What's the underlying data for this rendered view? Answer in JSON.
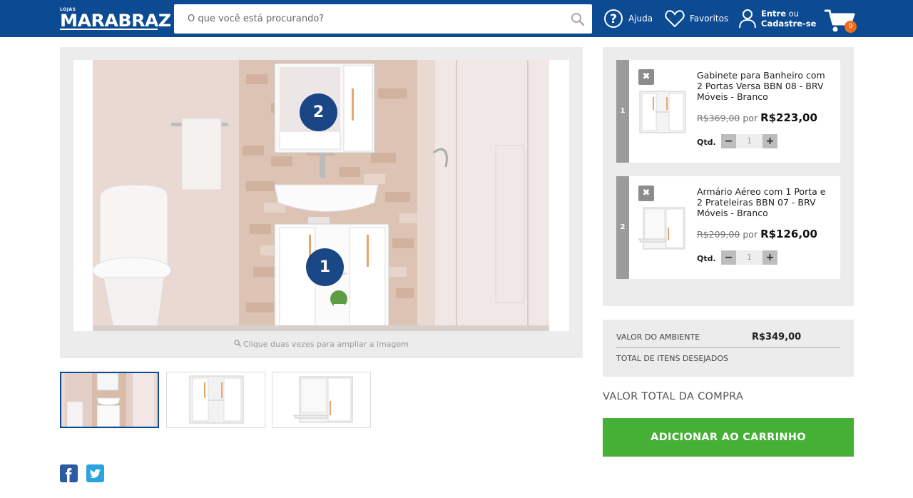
{
  "header": {
    "logo_small": "LOJAS",
    "logo_main": "MARABRAZ",
    "search_placeholder": "O que você está procurando?",
    "help_label": "Ajuda",
    "favorites_label": "Favoritos",
    "login_line1_bold": "Entre",
    "login_line1_rest": " ou",
    "login_line2": "Cadastre-se",
    "cart_count": "0"
  },
  "gallery": {
    "zoom_hint": "Clique duas vezes para ampliar a imagem",
    "hotspots": [
      "1",
      "2"
    ]
  },
  "items": [
    {
      "index": "1",
      "remove": "✖",
      "title": "Gabinete para Banheiro com 2 Portas Versa BBN 08 - BRV Móveis - Branco",
      "old_price": "R$369,00",
      "por": " por ",
      "price": "R$223,00",
      "qty_label": "Qtd.",
      "qty": "1"
    },
    {
      "index": "2",
      "remove": "✖",
      "title": "Armário Aéreo com 1 Porta e 2 Prateleiras BBN 07 - BRV Móveis - Branco",
      "old_price": "R$209,00",
      "por": " por ",
      "price": "R$126,00",
      "qty_label": "Qtd.",
      "qty": "1"
    }
  ],
  "summary": {
    "ambient_label": "VALOR DO AMBIENTE",
    "ambient_value": "R$349,00",
    "desired_label": "TOTAL DE ITENS DESEJADOS",
    "total_label": "VALOR TOTAL DA COMPRA",
    "add_to_cart": "ADICIONAR AO CARRINHO"
  },
  "colors": {
    "brand_blue": "#0c4a92",
    "cart_badge": "#f26b1d",
    "button_green": "#44b035",
    "facebook": "#2d5aa0",
    "twitter": "#2aa3e0"
  },
  "icons": [
    "search-icon",
    "help-icon",
    "heart-icon",
    "user-icon",
    "cart-icon",
    "remove-icon",
    "facebook-icon",
    "twitter-icon",
    "zoom-icon"
  ]
}
